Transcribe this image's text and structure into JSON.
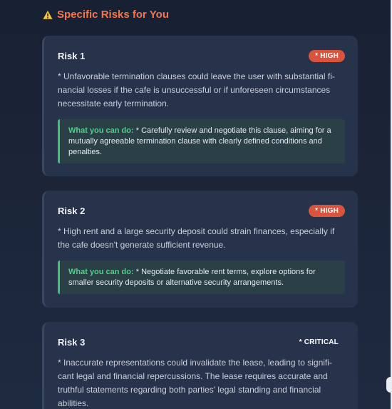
{
  "section": {
    "icon": "warning-icon",
    "title": "Specific Risks for You",
    "accent_color": "#f3764a"
  },
  "risks": [
    {
      "title": "Risk 1",
      "badge": "* HIGH",
      "description": "* Unfavorable termination clauses could leave the user with substantial fi-nancial losses if the cafe is unsuccessful or if unforeseen circumstances necessitate early termination.",
      "action_label": "What you can do:",
      "action_text": " * Carefully review and negotiate this clause, aiming for a mutually agreeable termination clause with clearly defined conditions and penalties."
    },
    {
      "title": "Risk 2",
      "badge": "* HIGH",
      "description": "* High rent and a large security deposit could strain finances, especially if the cafe doesn't generate sufficient revenue.",
      "action_label": "What you can do:",
      "action_text": " * Negotiate favorable rent terms, explore options for smaller security deposits or alternative security arrangements."
    },
    {
      "title": "Risk 3",
      "badge": "* CRITICAL",
      "description": "* Inaccurate representations could invalidate the lease, leading to signifi-cant legal and financial repercussions. The lease requires accurate and truthful statements regarding both parties' legal standing and financial abilities."
    }
  ],
  "colors": {
    "high_badge": "#d9533d",
    "action_accent": "#4fd08a",
    "card_bg": "#26334a"
  }
}
